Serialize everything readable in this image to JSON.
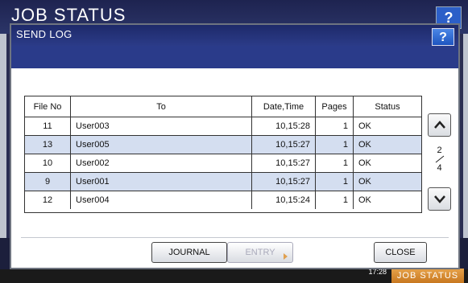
{
  "background": {
    "title": "JOB STATUS",
    "help_label": "?",
    "time": "17:28",
    "job_status_label": "JOB STATUS"
  },
  "dialog": {
    "title": "SEND LOG",
    "help_label": "?"
  },
  "table": {
    "headers": {
      "file_no": "File No",
      "to": "To",
      "date_time": "Date,Time",
      "pages": "Pages",
      "status": "Status"
    },
    "rows": [
      {
        "file_no": "11",
        "to": "User003",
        "date_time": "10,15:28",
        "pages": "1",
        "status": "OK"
      },
      {
        "file_no": "13",
        "to": "User005",
        "date_time": "10,15:27",
        "pages": "1",
        "status": "OK"
      },
      {
        "file_no": "10",
        "to": "User002",
        "date_time": "10,15:27",
        "pages": "1",
        "status": "OK"
      },
      {
        "file_no": "9",
        "to": "User001",
        "date_time": "10,15:27",
        "pages": "1",
        "status": "OK"
      },
      {
        "file_no": "12",
        "to": "User004",
        "date_time": "10,15:24",
        "pages": "1",
        "status": "OK"
      }
    ]
  },
  "pagination": {
    "current": "2",
    "total": "4"
  },
  "buttons": {
    "journal": "JOURNAL",
    "entry": "ENTRY",
    "close": "CLOSE"
  },
  "colors": {
    "header_bar": "#2a3b8a",
    "alt_row": "#d4def0",
    "help_button": "#2c5fc8",
    "job_status_button": "#e6a24a"
  },
  "icons": [
    "help-icon",
    "arrow-up-icon",
    "arrow-down-icon"
  ]
}
